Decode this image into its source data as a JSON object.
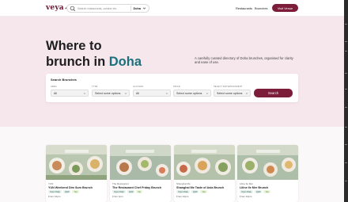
{
  "nav": {
    "logo_text": "veya",
    "search_placeholder": "Search restaurants, cuisine etc.",
    "city": "Doha",
    "links": [
      "Restaurants",
      "Brunches"
    ],
    "visit_button": "Visit Venue"
  },
  "hero": {
    "title_line1": "Where to",
    "title_line2_prefix": "brunch in ",
    "title_highlight": "Doha",
    "subtitle": "A carefully curated directory of Doha brunches, organised for clarity and ease of use."
  },
  "search_panel": {
    "title": "Search Brunches",
    "fields": [
      {
        "label": "AREA",
        "value": "All"
      },
      {
        "label": "TYPE",
        "value": "Select some options"
      },
      {
        "label": "ALCOHOL",
        "value": "All"
      },
      {
        "label": "PRICE",
        "value": "Select some options"
      },
      {
        "label": "SELECT ENTERTAINMENT",
        "value": "Select some options"
      }
    ],
    "search_button": "Search"
  },
  "cards": [
    {
      "type": "YUN",
      "name": "YUN Weekend Dim Sum Brunch",
      "tags": [
        "Open Daily",
        "QAR",
        "Yes"
      ],
      "time": "From 12pm"
    },
    {
      "type": "The Restaurant",
      "name": "The Restaurant Chef Friday Brunch",
      "tags": [
        "Open Daily",
        "QAR",
        "No"
      ],
      "time": "From 1pm"
    },
    {
      "type": "Shanghai Me",
      "name": "Shanghai Me Taste of Asia Brunch",
      "tags": [
        "Open Daily",
        "QAR",
        "Yes"
      ],
      "time": "From 12pm"
    },
    {
      "type": "Liline Ile Mer",
      "name": "Liline Ile Mer Brunch",
      "tags": [
        "Open Daily",
        "QAR",
        "Yes"
      ],
      "time": "From 12pm"
    }
  ],
  "colors": {
    "brand": "#7c1d3a",
    "accent": "#1c6f7d",
    "hero_bg": "#f6e7ec"
  }
}
